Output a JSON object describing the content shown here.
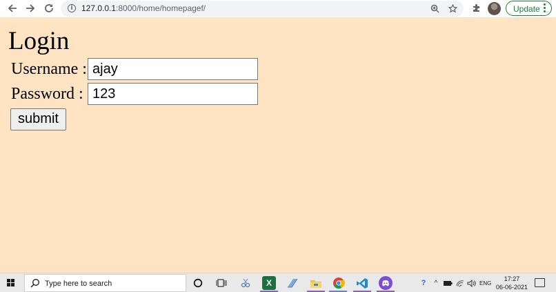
{
  "browser": {
    "url_host": "127.0.0.1",
    "url_path": ":8000/home/homepagef/",
    "update_label": "Update"
  },
  "page": {
    "title": "Login",
    "username_label": "Username :",
    "username_value": "ajay",
    "password_label": "Password :",
    "password_value": "123",
    "submit_label": "submit"
  },
  "taskbar": {
    "search_placeholder": "Type here to search",
    "language": "ENG",
    "time": "17:27",
    "date": "06-06-2021"
  },
  "colors": {
    "page_background": "#ffe4c4",
    "update_green": "#188038"
  }
}
